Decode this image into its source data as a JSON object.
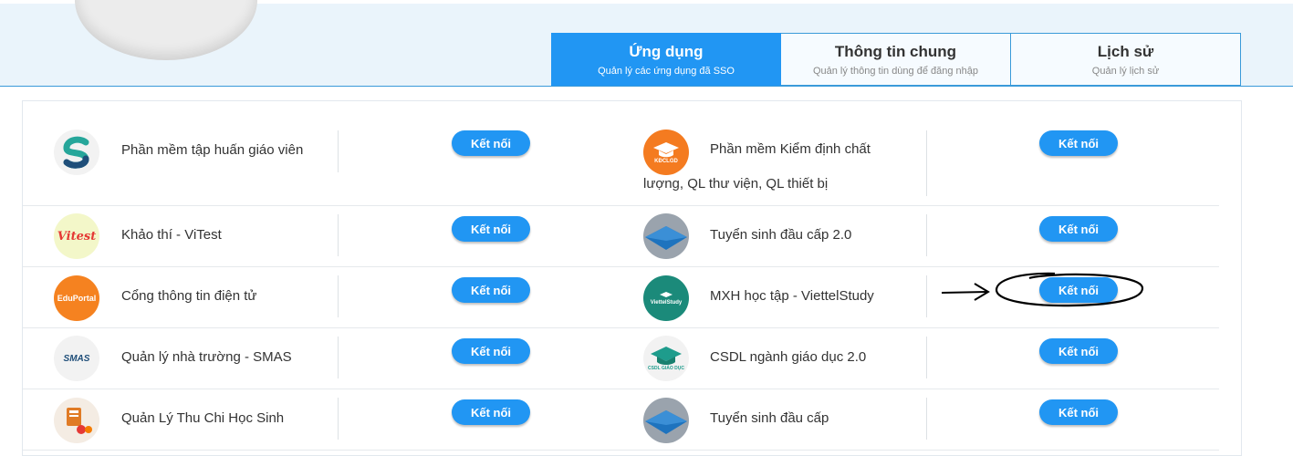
{
  "tabs": [
    {
      "title": "Ứng dụng",
      "subtitle": "Quản lý các ứng dụng đã SSO",
      "active": true
    },
    {
      "title": "Thông tin chung",
      "subtitle": "Quản lý thông tin dùng để đăng nhập",
      "active": false
    },
    {
      "title": "Lịch sử",
      "subtitle": "Quản lý lịch sử",
      "active": false
    }
  ],
  "connect_label": "Kết nối",
  "apps_left": [
    {
      "name": "Phần mềm tập huấn giáo viên",
      "icon": "s-logo-icon"
    },
    {
      "name": "Khảo thí - ViTest",
      "icon": "vitest-logo-icon"
    },
    {
      "name": "Cổng thông tin điện tử",
      "icon": "eduportal-logo-icon"
    },
    {
      "name": "Quản lý nhà trường - SMAS",
      "icon": "smas-logo-icon"
    },
    {
      "name": "Quản Lý Thu Chi Học Sinh",
      "icon": "school-fees-logo-icon"
    }
  ],
  "apps_right": [
    {
      "name_line1": "Phần mềm Kiểm định chất",
      "name_line2": "lượng, QL thư viện, QL thiết bị",
      "icon": "kdclgd-logo-icon",
      "icon_text": "KĐCLGD"
    },
    {
      "name": "Tuyển sinh đầu cấp 2.0",
      "icon": "graduation-cap-icon"
    },
    {
      "name": "MXH học tập - ViettelStudy",
      "icon": "viettelstudy-logo-icon",
      "icon_text": "ViettelStudy"
    },
    {
      "name": "CSDL ngành giáo dục 2.0",
      "icon": "csdl-logo-icon",
      "icon_text": "CSDL GIÁO DỤC"
    },
    {
      "name": "Tuyển sinh đầu cấp",
      "icon": "graduation-cap-icon"
    }
  ],
  "icon_texts": {
    "eduportal": "EduPortal",
    "smas": "SMAS",
    "vitest": "Vitest"
  },
  "colors": {
    "accent": "#2196f3",
    "border": "#3a9ad9",
    "header_bg": "#eaf4fb"
  }
}
